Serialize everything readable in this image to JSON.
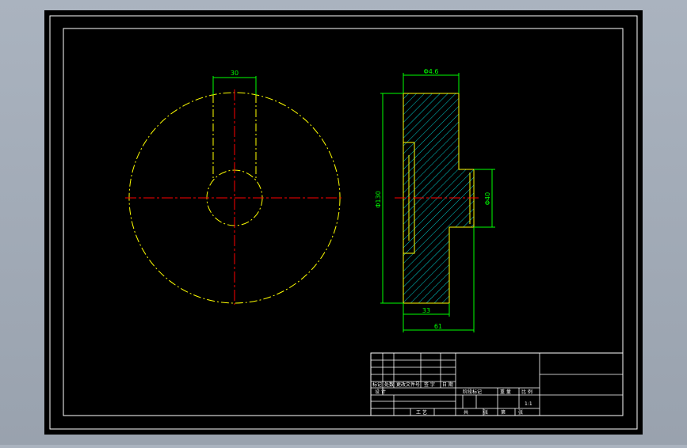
{
  "drawing": {
    "colors": {
      "background": "#000000",
      "frame": "#ffffff",
      "outline": "#ffff00",
      "centerline": "#ff0000",
      "dimension": "#00ff00",
      "hatch": "#00cccc"
    },
    "front_view": {
      "slot_width_dim": "30"
    },
    "section_view": {
      "top_width_dim": "Φ4.6",
      "outer_diameter_dim": "Φ130",
      "hub_diameter_dim": "Φ40",
      "flange_width_dim": "33",
      "overall_width_dim": "61"
    }
  },
  "title_block": {
    "col_labels": [
      "标记",
      "处数",
      "更改文件号",
      "签  字",
      "日  期"
    ],
    "designer_label": "设  计",
    "process_label": "工  艺",
    "stage_label": "阶段标记",
    "weight_label": "重  量",
    "scale_label": "比  例",
    "scale_value": "1:1",
    "approve_label": "共",
    "sheet_label": "张",
    "sheet_no_label": "第",
    "sheet_no_suffix": "张"
  }
}
